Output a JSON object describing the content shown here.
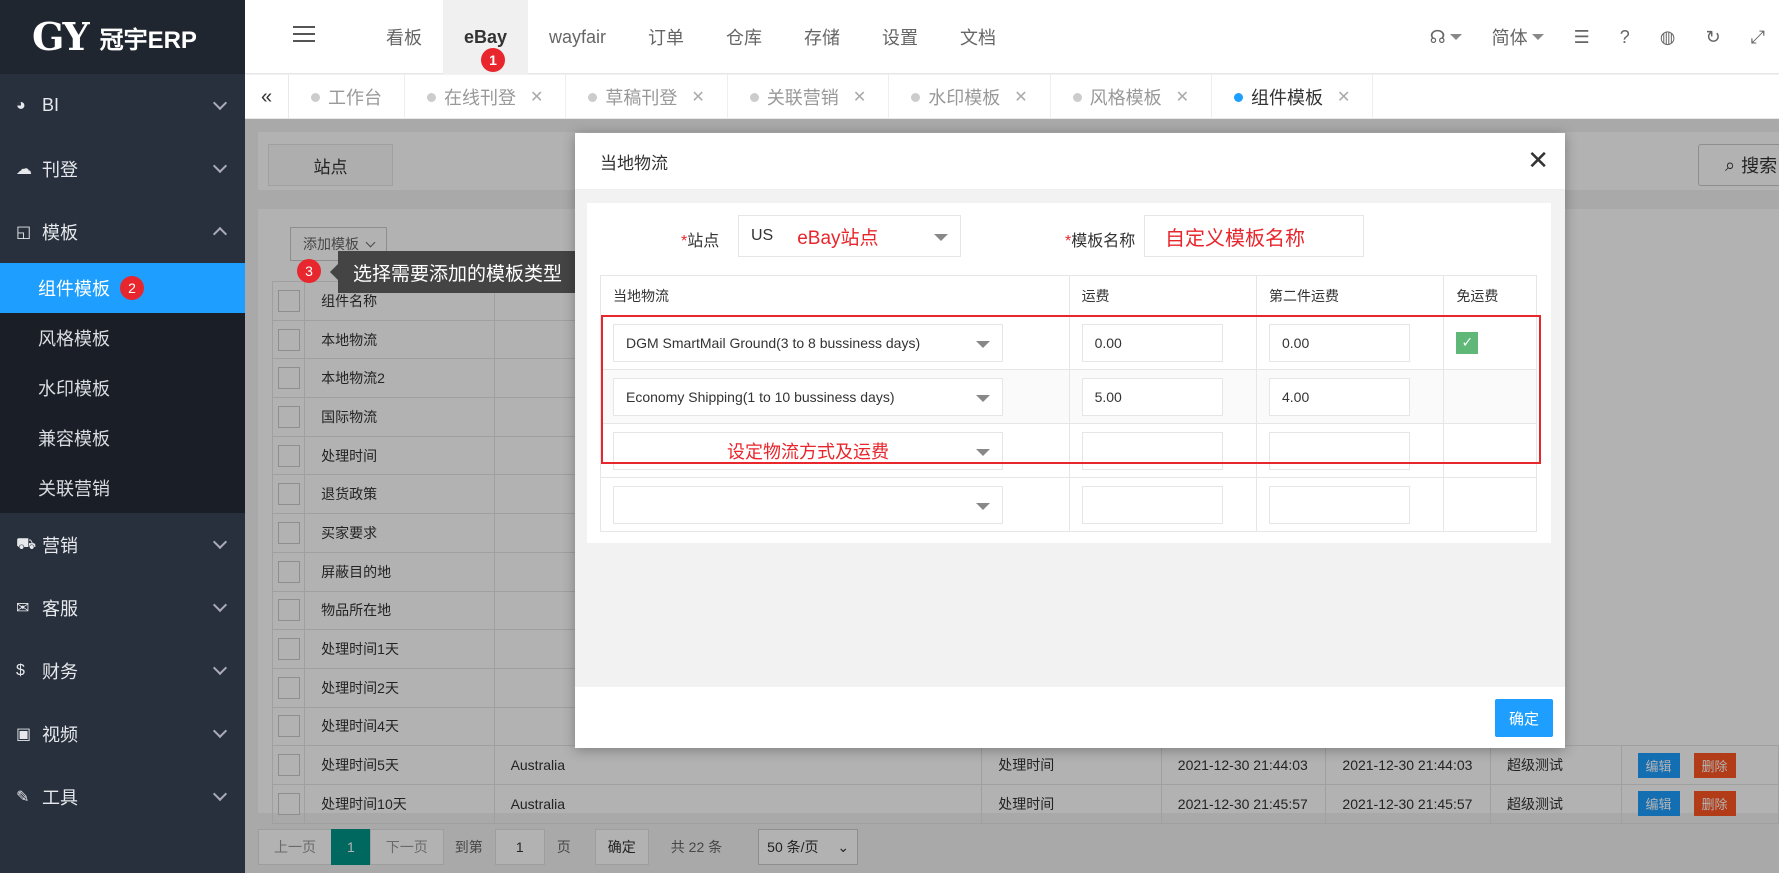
{
  "brand": {
    "logo_mark": "GY",
    "name": "冠宇ERP"
  },
  "sidebar": {
    "items": [
      {
        "label": "BI",
        "icon": "pie-chart-icon"
      },
      {
        "label": "刊登",
        "icon": "cloud-upload-icon"
      },
      {
        "label": "模板",
        "icon": "template-icon",
        "expanded": true
      },
      {
        "label": "营销",
        "icon": "cart-icon"
      },
      {
        "label": "客服",
        "icon": "mail-icon"
      },
      {
        "label": "财务",
        "icon": "dollar-icon"
      },
      {
        "label": "视频",
        "icon": "video-icon"
      },
      {
        "label": "工具",
        "icon": "wrench-icon"
      }
    ],
    "template_sub": [
      {
        "label": "组件模板",
        "active": true,
        "badge": "2"
      },
      {
        "label": "风格模板"
      },
      {
        "label": "水印模板"
      },
      {
        "label": "兼容模板"
      },
      {
        "label": "关联营销"
      }
    ]
  },
  "topnav": {
    "items": [
      "看板",
      "eBay",
      "wayfair",
      "订单",
      "仓库",
      "存储",
      "设置",
      "文档"
    ],
    "active": "eBay",
    "active_badge": "1",
    "language": "简体"
  },
  "tabs": [
    {
      "label": "工作台",
      "closable": false
    },
    {
      "label": "在线刊登",
      "closable": true
    },
    {
      "label": "草稿刊登",
      "closable": true
    },
    {
      "label": "关联营销",
      "closable": true
    },
    {
      "label": "水印模板",
      "closable": true
    },
    {
      "label": "风格模板",
      "closable": true
    },
    {
      "label": "组件模板",
      "closable": true,
      "active": true
    }
  ],
  "filter": {
    "site_label": "站点",
    "search_label": "搜索"
  },
  "panel": {
    "add_button": "添加模板",
    "tooltip_badge": "3",
    "tooltip": "选择需要添加的模板类型",
    "header_col": "组件名称",
    "rows": [
      {
        "name": "本地物流"
      },
      {
        "name": "本地物流2"
      },
      {
        "name": "国际物流"
      },
      {
        "name": "处理时间"
      },
      {
        "name": "退货政策"
      },
      {
        "name": "买家要求"
      },
      {
        "name": "屏蔽目的地"
      },
      {
        "name": "物品所在地"
      },
      {
        "name": "处理时间1天"
      },
      {
        "name": "处理时间2天"
      },
      {
        "name": "处理时间4天"
      },
      {
        "name": "处理时间5天",
        "site": "Australia",
        "type": "处理时间",
        "created": "2021-12-30 21:44:03",
        "updated": "2021-12-30 21:44:03",
        "user": "超级测试"
      },
      {
        "name": "处理时间10天",
        "site": "Australia",
        "type": "处理时间",
        "created": "2021-12-30 21:45:57",
        "updated": "2021-12-30 21:45:57",
        "user": "超级测试"
      }
    ],
    "edit_label": "编辑",
    "delete_label": "删除"
  },
  "pager": {
    "prev": "上一页",
    "current": "1",
    "next": "下一页",
    "goto_label": "到第",
    "goto_value": "1",
    "page_unit": "页",
    "confirm": "确定",
    "total": "共 22 条",
    "page_size": "50 条/页"
  },
  "modal": {
    "title": "当地物流",
    "site_label": "站点",
    "site_value": "US",
    "site_annotation": "eBay站点",
    "name_label": "模板名称",
    "name_annotation": "自定义模板名称",
    "columns": [
      "当地物流",
      "运费",
      "第二件运费",
      "免运费"
    ],
    "rows": [
      {
        "service": "DGM SmartMail Ground(3 to 8  bussiness days)",
        "cost": "0.00",
        "additional": "0.00",
        "free": true
      },
      {
        "service": "Economy Shipping(1 to 10  bussiness days)",
        "cost": "5.00",
        "additional": "4.00",
        "free": false
      },
      {
        "service": "",
        "cost": "",
        "additional": "",
        "free": false
      },
      {
        "service": "",
        "cost": "",
        "additional": "",
        "free": false
      }
    ],
    "rows_annotation": "设定物流方式及运费",
    "confirm": "确定"
  },
  "colors": {
    "accent": "#1e9fff",
    "danger": "#ff5722",
    "annotation": "#e8262d",
    "sidebar": "#28303d",
    "success": "#5fb878"
  }
}
